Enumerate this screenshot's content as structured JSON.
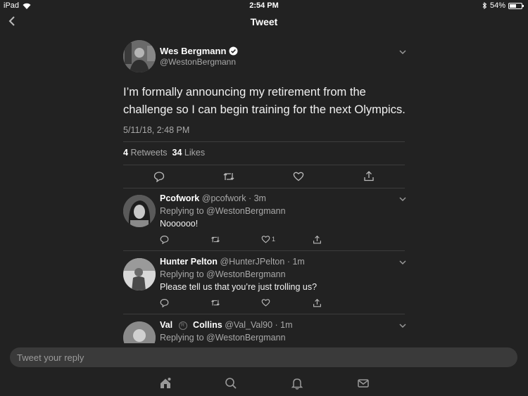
{
  "status_bar": {
    "device": "iPad",
    "time": "2:54 PM",
    "battery": "54%",
    "battery_level": 0.54
  },
  "nav": {
    "title": "Tweet"
  },
  "tweet": {
    "name": "Wes Bergmann",
    "handle": "@WestonBergmann",
    "text": "I’m formally announcing my retirement from the challenge so I can begin training for the next Olympics.",
    "timestamp": "5/11/18, 2:48 PM",
    "retweets": "4",
    "retweets_label": "Retweets",
    "likes": "34",
    "likes_label": "Likes"
  },
  "replies": [
    {
      "name": "Pcofwork",
      "handle": "@pcofwork",
      "time": "· 3m",
      "replying": "Replying to @WestonBergmann",
      "text": "Noooooo!",
      "like_count": "1"
    },
    {
      "name": "Hunter Pelton",
      "handle": "@HunterJPelton",
      "time": "· 1m",
      "replying": "Replying to @WestonBergmann",
      "text": "Please tell us that you’re just trolling us?",
      "like_count": ""
    },
    {
      "name": "Val",
      "name2": "Collins",
      "handle": "@Val_Val90",
      "time": "· 1m",
      "replying": "Replying to @WestonBergmann",
      "text": "",
      "like_count": ""
    }
  ],
  "reply_box": {
    "placeholder": "Tweet your reply"
  },
  "tabs": [
    "home-icon",
    "search-icon",
    "notifications-icon",
    "messages-icon"
  ]
}
